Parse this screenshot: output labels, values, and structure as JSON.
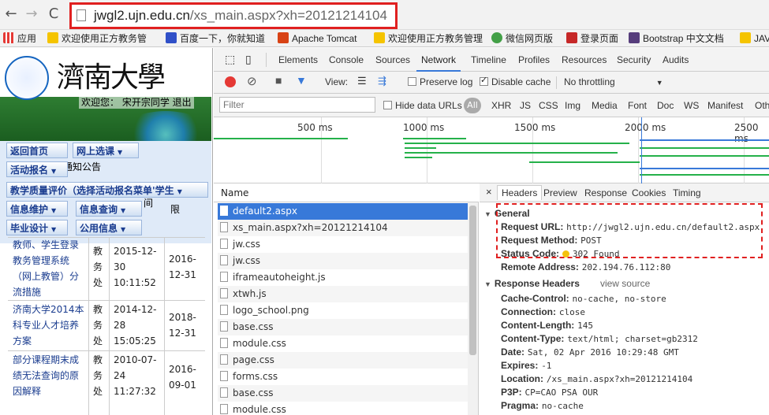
{
  "browser": {
    "url_host": "jwgl2.ujn.edu.cn",
    "url_path": "/xs_main.aspx?xh=20121214104",
    "bookmarks": [
      "应用",
      "欢迎使用正方教务管",
      "百度一下，你就知道",
      "Apache Tomcat",
      "欢迎使用正方教务管理",
      "微信网页版",
      "登录页面",
      "Bootstrap 中文文档",
      "JAV"
    ]
  },
  "left_page": {
    "logo_text": "濟南大學",
    "welcome": "欢迎您：  宋开宗同学   退出",
    "menu": {
      "return_home": "返回首页",
      "online_select": "网上选课",
      "activity_signup": "活动报名",
      "notice_bg": "通知公告",
      "teaching_eval": "教学质量评价（选择活动报名菜单'学生",
      "info_maint": "信息维护",
      "info_query": "信息查询",
      "graduation": "毕业设计",
      "public_info": "公用信息"
    },
    "notice_fragments": {
      "col_time": "间",
      "col_limit": "限"
    },
    "notices": [
      {
        "title": "教师、学生登录教务管理系统（网上教管）分流措施",
        "dept": "教务处",
        "date": "2015-12-30 10:11:52",
        "expire": "2016-12-31"
      },
      {
        "title": "济南大学2014本科专业人才培养方案",
        "dept": "教务处",
        "date": "2014-12-28 15:05:25",
        "expire": "2018-12-31"
      },
      {
        "title": "部分课程期末成绩无法查询的原因解释",
        "dept": "教务处",
        "date": "2010-07-24 11:27:32",
        "expire": "2016-09-01"
      }
    ]
  },
  "devtools": {
    "tabs": [
      "Elements",
      "Console",
      "Sources",
      "Network",
      "Timeline",
      "Profiles",
      "Resources",
      "Security",
      "Audits"
    ],
    "active_tab": "Network",
    "toolbar": {
      "view_label": "View:",
      "preserve_log": "Preserve log",
      "disable_cache": "Disable cache",
      "throttling": "No throttling"
    },
    "filter": {
      "placeholder": "Filter",
      "hide_data_urls": "Hide data URLs",
      "types": [
        "All",
        "XHR",
        "JS",
        "CSS",
        "Img",
        "Media",
        "Font",
        "Doc",
        "WS",
        "Manifest",
        "Oth"
      ]
    },
    "timeline_ticks": [
      "500 ms",
      "1000 ms",
      "1500 ms",
      "2000 ms",
      "2500 ms"
    ],
    "requests_header": "Name",
    "requests": [
      "default2.aspx",
      "xs_main.aspx?xh=20121214104",
      "jw.css",
      "jw.css",
      "iframeautoheight.js",
      "xtwh.js",
      "logo_school.png",
      "base.css",
      "module.css",
      "page.css",
      "forms.css",
      "base.css",
      "module.css"
    ],
    "selected_request": "default2.aspx",
    "detail_tabs": [
      "Headers",
      "Preview",
      "Response",
      "Cookies",
      "Timing"
    ],
    "general": {
      "title": "General",
      "request_url_label": "Request URL:",
      "request_url": "http://jwgl2.ujn.edu.cn/default2.aspx",
      "method_label": "Request Method:",
      "method": "POST",
      "status_label": "Status Code:",
      "status": "302 Found",
      "remote_label": "Remote Address:",
      "remote": "202.194.76.112:80"
    },
    "response_headers": {
      "title": "Response Headers",
      "view_source": "view source",
      "items": [
        {
          "k": "Cache-Control:",
          "v": "no-cache, no-store"
        },
        {
          "k": "Connection:",
          "v": "close"
        },
        {
          "k": "Content-Length:",
          "v": "145"
        },
        {
          "k": "Content-Type:",
          "v": "text/html; charset=gb2312"
        },
        {
          "k": "Date:",
          "v": "Sat, 02 Apr 2016 10:29:48 GMT"
        },
        {
          "k": "Expires:",
          "v": "-1"
        },
        {
          "k": "Location:",
          "v": "/xs_main.aspx?xh=20121214104"
        },
        {
          "k": "P3P:",
          "v": "CP=CAO PSA OUR"
        },
        {
          "k": "Pragma:",
          "v": "no-cache"
        }
      ]
    }
  }
}
